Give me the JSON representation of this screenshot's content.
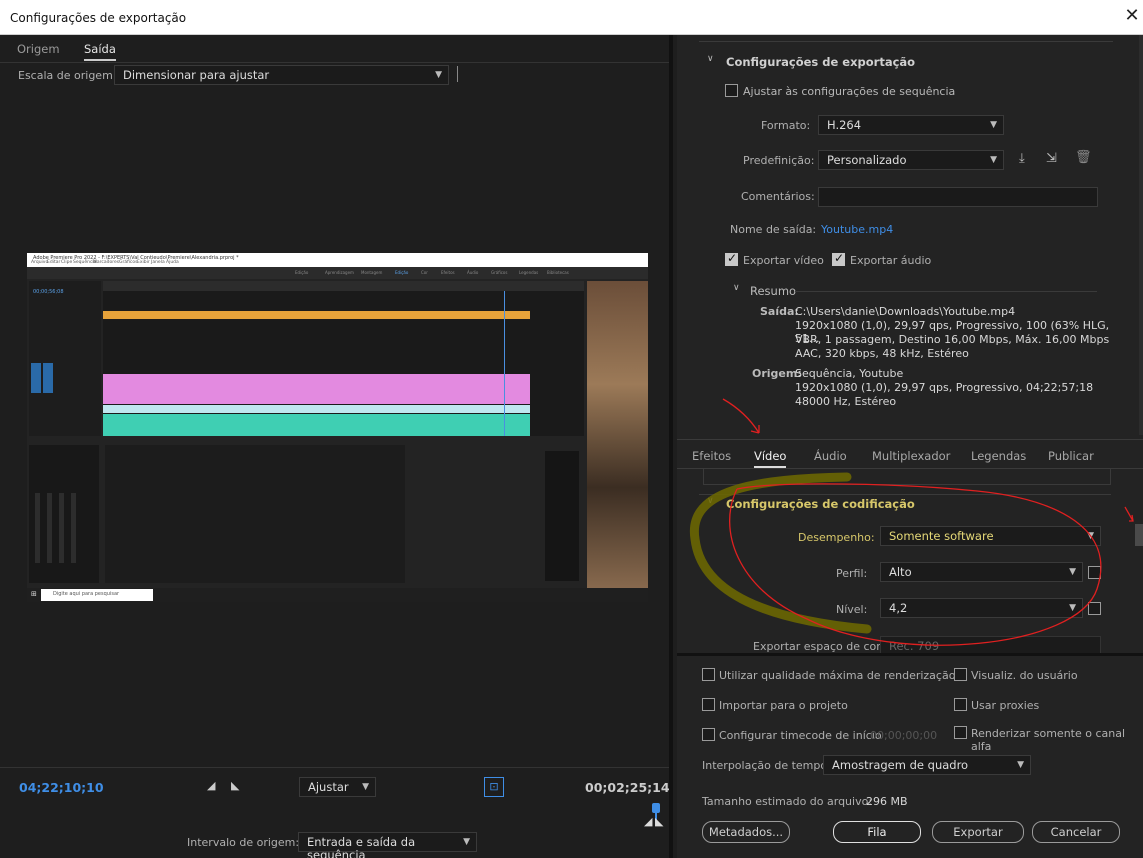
{
  "window": {
    "title": "Configurações de exportação",
    "close": "✕"
  },
  "left": {
    "tabs": [
      {
        "label": "Origem"
      },
      {
        "label": "Saída"
      }
    ],
    "source_scale": {
      "label": "Escala de origem:",
      "value": "Dimensionar para ajustar"
    },
    "preview": {
      "app_title": "Adobe Premiere Pro 2022 - F:\\EXPERTS\\Val Contieudo\\Premiere\\Alexandria.prproj *",
      "menu": [
        "Arquivo",
        "Editar",
        "Clipe",
        "Sequência",
        "Marcadores",
        "Gráficos",
        "Exibir",
        "Janela",
        "Ajuda"
      ],
      "workspaces": [
        "Edição",
        "Aprendizagem",
        "Montagem",
        "Edição",
        "Cor",
        "Efeitos",
        "Áudio",
        "Gráficos",
        "Legendas",
        "Bibliotecas"
      ],
      "timecode": "00;00;56;08",
      "taskbar_search": "Digite aqui para pesquisar"
    },
    "timecode_in": "04;22;10;10",
    "timecode_out": "00;02;25;14",
    "zoom": {
      "value": "Ajustar"
    },
    "source_range": {
      "label": "Intervalo de origem:",
      "value": "Entrada e saída da sequência"
    }
  },
  "export": {
    "section_title": "Configurações de exportação",
    "match_sequence": {
      "label": "Ajustar às configurações de sequência",
      "checked": false
    },
    "format": {
      "label": "Formato:",
      "value": "H.264"
    },
    "preset": {
      "label": "Predefinição:",
      "value": "Personalizado"
    },
    "comments": {
      "label": "Comentários:",
      "value": ""
    },
    "output_name": {
      "label": "Nome de saída:",
      "value": "Youtube.mp4"
    },
    "export_video": {
      "label": "Exportar vídeo",
      "checked": true
    },
    "export_audio": {
      "label": "Exportar áudio",
      "checked": true
    },
    "summary": {
      "title": "Resumo",
      "output_label": "Saída:",
      "output_lines": [
        "C:\\Users\\danie\\Downloads\\Youtube.mp4",
        "1920x1080 (1,0), 29,97 qps, Progressivo, 100 (63% HLG, 51...",
        "VBR, 1 passagem, Destino 16,00 Mbps, Máx. 16,00 Mbps",
        "AAC, 320 kbps, 48 kHz, Estéreo"
      ],
      "source_label": "Origem:",
      "source_lines": [
        "Sequência, Youtube",
        "1920x1080 (1,0), 29,97  qps, Progressivo, 04;22;57;18",
        "48000 Hz, Estéreo"
      ]
    }
  },
  "tabs": [
    {
      "label": "Efeitos"
    },
    {
      "label": "Vídeo"
    },
    {
      "label": "Áudio"
    },
    {
      "label": "Multiplexador"
    },
    {
      "label": "Legendas"
    },
    {
      "label": "Publicar"
    }
  ],
  "encoding": {
    "title": "Configurações de codificação",
    "performance": {
      "label": "Desempenho:",
      "value": "Somente software"
    },
    "profile": {
      "label": "Perfil:",
      "value": "Alto"
    },
    "level": {
      "label": "Nível:",
      "value": "4,2"
    },
    "color_space": {
      "label": "Exportar espaço de cor:",
      "value": "Rec. 709"
    }
  },
  "options": {
    "max_render_quality": "Utilizar qualidade máxima de renderização",
    "user_view": "Visualiz. do usuário",
    "import_to_project": "Importar para o projeto",
    "use_proxies": "Usar proxies",
    "set_start_timecode": "Configurar timecode de início",
    "start_timecode": "00;00;00;00",
    "render_alpha_only": "Renderizar somente o canal alfa",
    "time_interpolation": {
      "label": "Interpolação de tempo:",
      "value": "Amostragem de quadro"
    },
    "file_size": {
      "label": "Tamanho estimado do arquivo:",
      "value": "296 MB"
    }
  },
  "buttons": {
    "metadata": "Metadados...",
    "queue": "Fila",
    "export": "Exportar",
    "cancel": "Cancelar"
  },
  "colors": {
    "accent_blue": "#3f8ee6",
    "annotation_red": "#e02020",
    "annotation_yellow": "#7a7400"
  }
}
